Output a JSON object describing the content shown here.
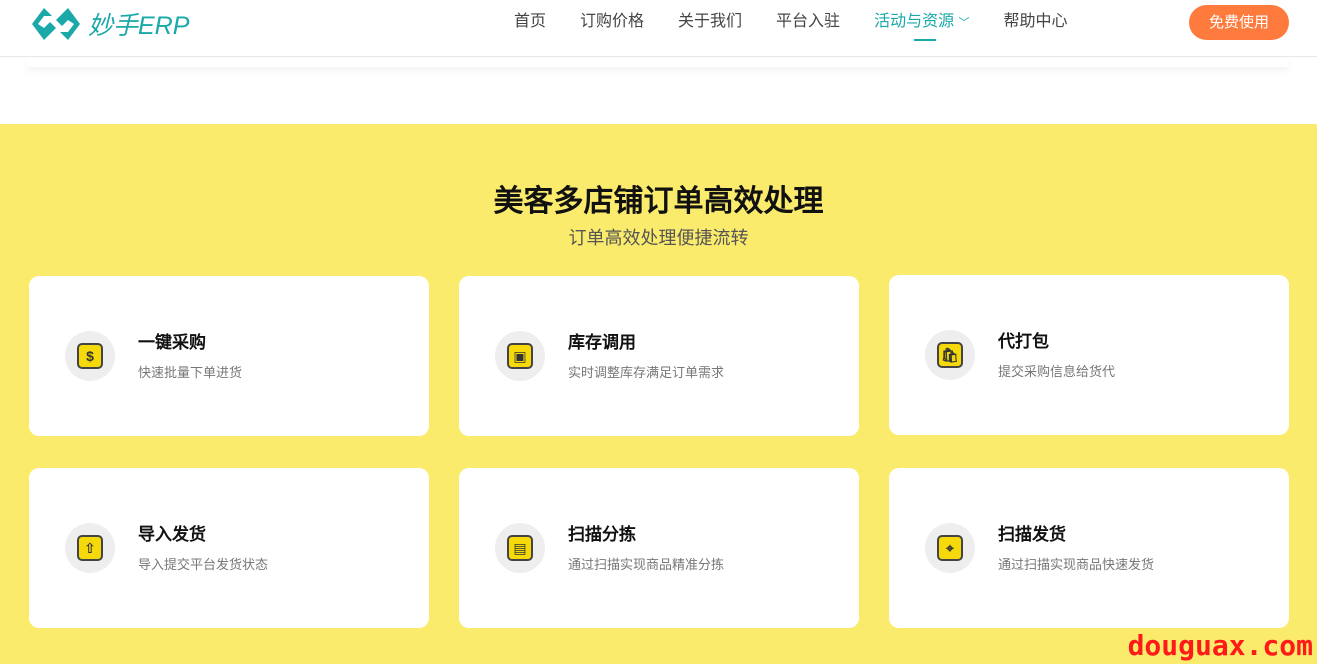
{
  "header": {
    "logo": "妙手ERP",
    "nav": [
      "首页",
      "订购价格",
      "关于我们",
      "平台入驻",
      "活动与资源",
      "帮助中心"
    ],
    "active_index": 4,
    "cta": "免费使用"
  },
  "section": {
    "title": "美客多店铺订单高效处理",
    "subtitle": "订单高效处理便捷流转",
    "cards": [
      {
        "title": "一键采购",
        "desc": "快速批量下单进货",
        "icon": "coin-icon"
      },
      {
        "title": "库存调用",
        "desc": "实时调整库存满足订单需求",
        "icon": "inventory-box-icon"
      },
      {
        "title": "代打包",
        "desc": "提交采购信息给货代",
        "icon": "package-bag-icon"
      },
      {
        "title": "导入发货",
        "desc": "导入提交平台发货状态",
        "icon": "upload-icon"
      },
      {
        "title": "扫描分拣",
        "desc": "通过扫描实现商品精准分拣",
        "icon": "scan-icon"
      },
      {
        "title": "扫描发货",
        "desc": "通过扫描实现商品快速发货",
        "icon": "map-pin-icon"
      }
    ]
  },
  "watermark": "douguax.com",
  "colors": {
    "brand": "#1aa8a8",
    "cta": "#ff7a3d",
    "section_bg": "#faeb6c"
  }
}
